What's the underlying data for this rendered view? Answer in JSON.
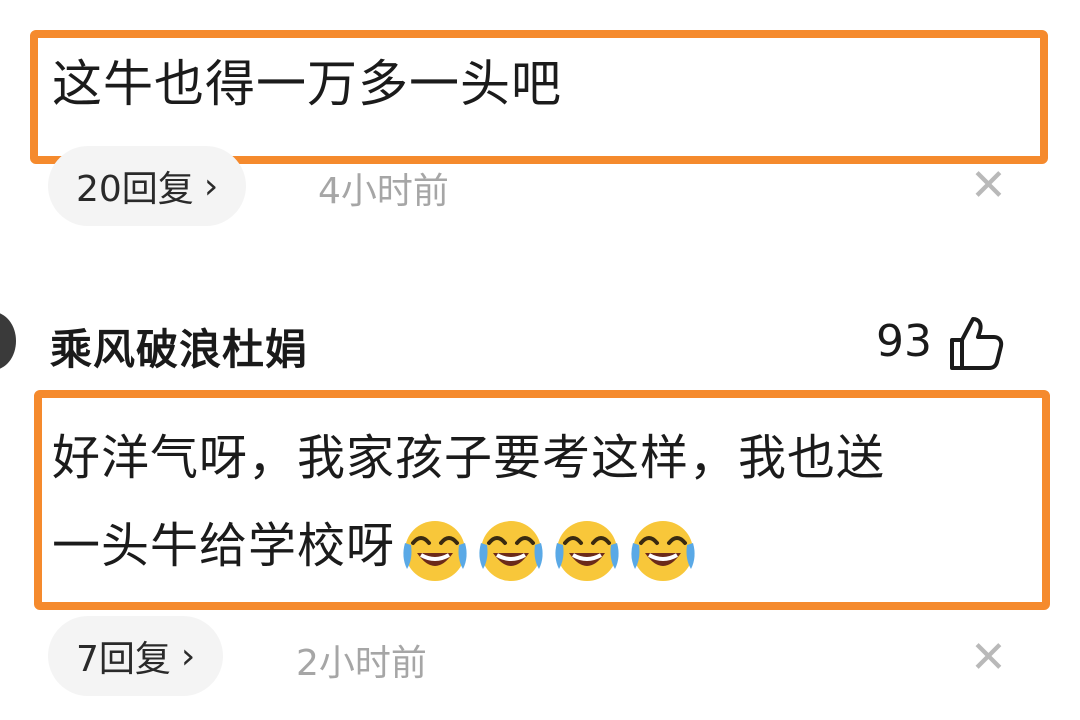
{
  "comments": [
    {
      "text": "这牛也得一万多一头吧",
      "replies": "20回复",
      "time": "4小时前"
    },
    {
      "username": "乘风破浪杜娟",
      "likes": "93",
      "text_line1": "好洋气呀，我家孩子要考这样，我也送",
      "text_line2": "一头牛给学校呀",
      "emoji_count": 4,
      "emoji_name": "laughing-crying-emoji",
      "replies": "7回复",
      "time": "2小时前"
    }
  ],
  "icons": {
    "reply_chevron": "chevron-right-icon",
    "dismiss": "close-icon",
    "like": "thumbs-up-icon"
  },
  "colors": {
    "highlight_border": "#f58a2d",
    "reply_pill_bg": "#f4f4f4",
    "timestamp": "#a6a6a6"
  }
}
